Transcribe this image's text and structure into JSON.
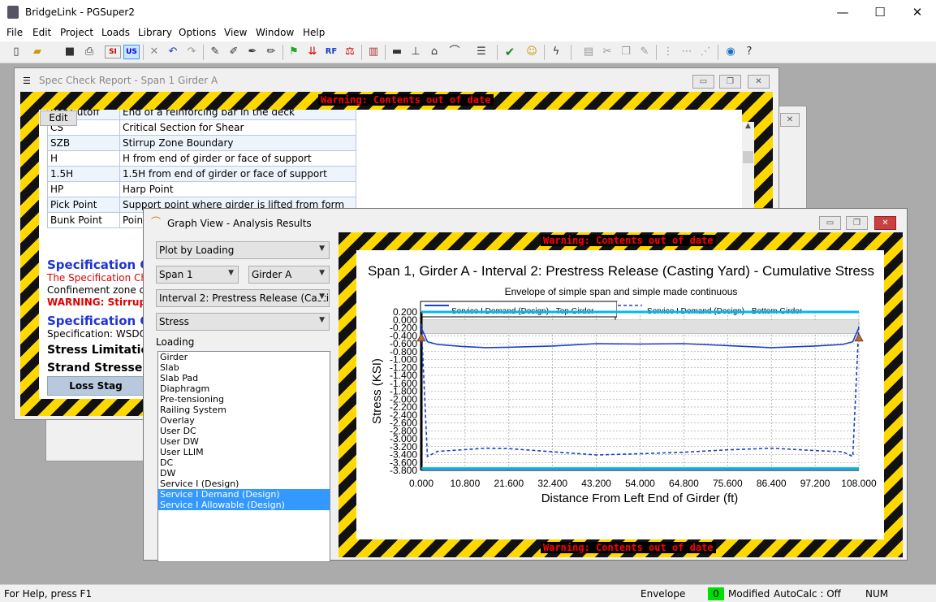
{
  "app": {
    "title": "BridgeLink - PGSuper2"
  },
  "window_controls": {
    "minimize": "—",
    "maximize": "☐",
    "close": "✕"
  },
  "menu": [
    "File",
    "Edit",
    "Project",
    "Loads",
    "Library",
    "Options",
    "View",
    "Window",
    "Help"
  ],
  "toolbar": {
    "si_label": "SI",
    "us_label": "US",
    "rf_label": "RF"
  },
  "warning_text": "Warning: Contents out of date",
  "spec_window": {
    "title": "Spec Check Report - Span 1 Girder A",
    "edit_button": "Edit",
    "partial_row": {
      "term": "Bar Cutoff",
      "desc": "End of a reinforcing bar in the deck"
    },
    "rows": [
      {
        "term": "CS",
        "desc": "Critical Section for Shear"
      },
      {
        "term": "SZB",
        "desc": "Stirrup Zone Boundary"
      },
      {
        "term": "H",
        "desc": "H from end of girder or face of support"
      },
      {
        "term": "1.5H",
        "desc": "1.5H from end of girder or face of support"
      },
      {
        "term": "HP",
        "desc": "Harp Point"
      },
      {
        "term": "Pick Point",
        "desc": "Support point where girder is lifted from form"
      },
      {
        "term": "Bunk Point",
        "desc": "Point"
      }
    ],
    "heading1": "Specification C",
    "red_text": "The Specification Che",
    "conf_text": "Confinement zone che",
    "warning_line": "WARNING: Stirrup zon",
    "heading2": "Specification C",
    "spec_line": "Specification: WSDOT",
    "stress_heading": "Stress Limitation",
    "strand_heading": "Strand Stresses",
    "loss_stage": "Loss Stag"
  },
  "graph_window": {
    "title": "Graph View - Analysis Results",
    "plot_mode": "Plot by Loading",
    "span": "Span 1",
    "girder": "Girder A",
    "interval": "Interval 2: Prestress Release (Casting Yard)",
    "action": "Stress",
    "loading_label": "Loading",
    "loadings": [
      "Girder",
      "Slab",
      "Slab Pad",
      "Diaphragm",
      "Pre-tensioning",
      "Railing System",
      "Overlay",
      "User DC",
      "User DW",
      "User LLIM",
      "DC",
      "DW",
      "Service I (Design)",
      "Service I Demand (Design)",
      "Service I Allowable (Design)"
    ],
    "selected_loadings": [
      "Service I Demand (Design)",
      "Service I Allowable (Design)"
    ]
  },
  "chart_data": {
    "type": "line",
    "title": "Span 1, Girder A - Interval 2: Prestress Release (Casting Yard) - Cumulative Stress",
    "subtitle": "Envelope of simple span and simple made continuous",
    "xlabel": "Distance From Left End of Girder (ft)",
    "ylabel": "Stress (KSI)",
    "xlim": [
      0,
      108
    ],
    "ylim": [
      -3.8,
      0.2
    ],
    "x_ticks": [
      "0.000",
      "10.800",
      "21.600",
      "32.400",
      "43.200",
      "54.000",
      "64.800",
      "75.600",
      "86.400",
      "97.200",
      "108.000"
    ],
    "y_ticks": [
      "0.200",
      "0.000",
      "-0.200",
      "-0.400",
      "-0.600",
      "-0.800",
      "-1.000",
      "-1.200",
      "-1.400",
      "-1.600",
      "-1.800",
      "-2.000",
      "-2.200",
      "-2.400",
      "-2.600",
      "-2.800",
      "-3.000",
      "-3.200",
      "-3.400",
      "-3.600",
      "-3.800"
    ],
    "grid": true,
    "series": [
      {
        "name": "Service I Demand (Design) - Top Girder",
        "color": "#1a3fc8",
        "style": "solid",
        "x": [
          0,
          1.5,
          4,
          10,
          16,
          21.6,
          32.4,
          43.2,
          54,
          64.8,
          75.6,
          86.4,
          97.2,
          104,
          106.5,
          108
        ],
        "y": [
          -0.2,
          -0.55,
          -0.62,
          -0.67,
          -0.7,
          -0.69,
          -0.66,
          -0.6,
          -0.61,
          -0.6,
          -0.65,
          -0.7,
          -0.66,
          -0.62,
          -0.55,
          -0.2
        ]
      },
      {
        "name": "Service I Demand (Design) - Bottom Girder",
        "color": "#1a3fc8",
        "style": "dashed",
        "x": [
          0,
          1.5,
          4,
          10,
          16,
          21.6,
          32.4,
          43.2,
          54,
          64.8,
          75.6,
          86.4,
          97.2,
          104,
          106.5,
          108
        ],
        "y": [
          -0.1,
          -3.45,
          -3.32,
          -3.28,
          -3.24,
          -3.25,
          -3.33,
          -3.41,
          -3.38,
          -3.34,
          -3.28,
          -3.24,
          -3.3,
          -3.33,
          -3.45,
          -0.1
        ]
      },
      {
        "name": "Service I Allowable (Design)",
        "color": "#00b8f0",
        "style": "solid",
        "x": [
          0,
          108
        ],
        "y": [
          0.2,
          0.2
        ]
      },
      {
        "name": "Service I Allowable (Design)",
        "color": "#00b8f0",
        "style": "solid",
        "x": [
          0,
          108
        ],
        "y": [
          -3.75,
          -3.75
        ]
      }
    ],
    "band": {
      "x": [
        0,
        108
      ],
      "y_top": 0.0,
      "y_bottom": -0.35,
      "color": "#e0e0e0"
    },
    "supports_x": [
      0,
      108
    ]
  },
  "statusbar": {
    "help": "For Help, press F1",
    "mode": "Envelope",
    "count": "0",
    "modified": "Modified",
    "autocalc": "AutoCalc : Off",
    "num": "NUM"
  },
  "colors": {
    "selection": "#3399ff",
    "warning_red": "#ff0000",
    "hatch_yellow": "#ffd800",
    "heading_blue": "#1f33d6"
  }
}
